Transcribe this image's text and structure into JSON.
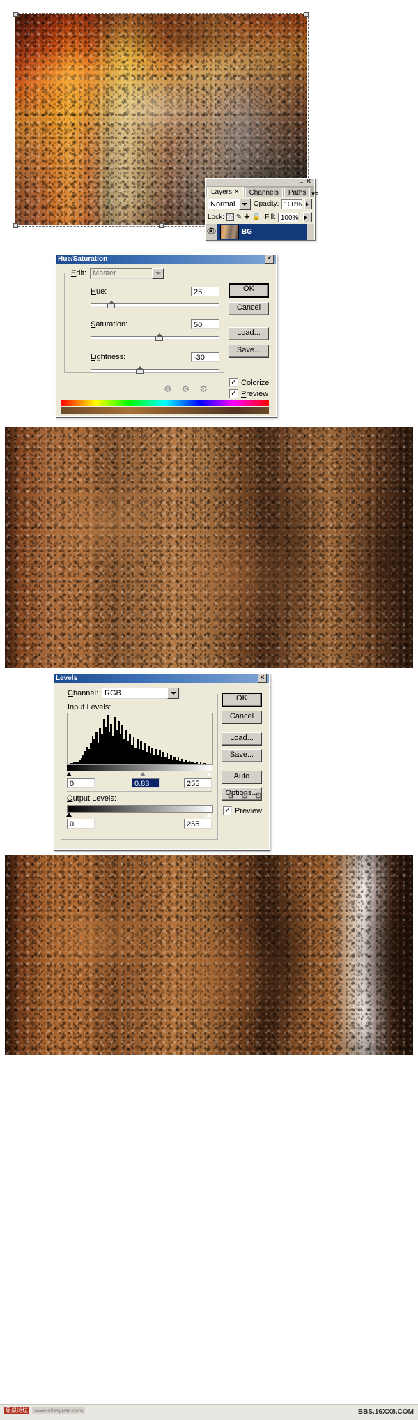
{
  "app": "Adobe Photoshop tutorial screenshot",
  "layers_palette": {
    "tabs": [
      {
        "label": "Layers",
        "active": true,
        "close_icon": "close-x-icon"
      },
      {
        "label": "Channels",
        "active": false
      },
      {
        "label": "Paths",
        "active": false
      }
    ],
    "menu_icon": "palette-menu-icon",
    "minimize_icon": "minimize-icon",
    "close_icon": "close-icon",
    "blend_mode": "Normal",
    "opacity_label": "Opacity:",
    "opacity_value": "100%",
    "lock_label": "Lock:",
    "lock_icons": [
      "lock-transparent-pixels-icon",
      "lock-image-pixels-icon",
      "lock-position-icon",
      "lock-all-icon"
    ],
    "fill_label": "Fill:",
    "fill_value": "100%",
    "layer": {
      "name": "BG",
      "visible": true,
      "eye_icon": "eye-visibility-icon"
    }
  },
  "hue_saturation_dialog": {
    "title": "Hue/Saturation",
    "close_icon": "close-icon",
    "edit_label": "Edit:",
    "edit_value": "Master",
    "fields": [
      {
        "label": "Hue:",
        "value": "25",
        "slider_pct": 13
      },
      {
        "label": "Saturation:",
        "value": "50",
        "slider_pct": 50
      },
      {
        "label": "Lightness:",
        "value": "-30",
        "slider_pct": 35
      }
    ],
    "buttons": [
      {
        "label": "OK",
        "default": true
      },
      {
        "label": "Cancel",
        "default": false
      },
      {
        "label": "Load...",
        "default": false
      },
      {
        "label": "Save...",
        "default": false
      }
    ],
    "checkboxes": [
      {
        "label": "Colorize",
        "checked": true
      },
      {
        "label": "Preview",
        "checked": true
      }
    ],
    "eyedropper_icons": [
      "eyedropper-icon",
      "eyedropper-plus-icon",
      "eyedropper-minus-icon"
    ],
    "spectrum_bars": 2
  },
  "levels_dialog": {
    "title": "Levels",
    "close_icon": "close-icon",
    "channel_label": "Channel:",
    "channel_value": "RGB",
    "input_levels_label": "Input Levels:",
    "input_values": [
      "0",
      "0.83",
      "255"
    ],
    "input_selected_index": 1,
    "output_levels_label": "Output Levels:",
    "output_values": [
      "0",
      "255"
    ],
    "buttons": [
      {
        "label": "OK",
        "default": true
      },
      {
        "label": "Cancel",
        "default": false
      },
      {
        "label": "Load...",
        "default": false
      },
      {
        "label": "Save...",
        "default": false
      },
      {
        "label": "Auto",
        "default": false
      },
      {
        "label": "Options...",
        "default": false
      }
    ],
    "preview": {
      "label": "Preview",
      "checked": true
    },
    "eyedropper_icons": [
      "eyedropper-black-icon",
      "eyedropper-gray-icon",
      "eyedropper-white-icon"
    ],
    "histogram": [
      2,
      3,
      3,
      4,
      5,
      6,
      8,
      12,
      18,
      26,
      34,
      30,
      42,
      55,
      48,
      62,
      40,
      70,
      58,
      88,
      72,
      96,
      64,
      78,
      55,
      92,
      68,
      84,
      58,
      76,
      50,
      66,
      44,
      60,
      38,
      54,
      33,
      48,
      30,
      44,
      27,
      40,
      24,
      36,
      21,
      33,
      19,
      30,
      17,
      27,
      15,
      24,
      13,
      21,
      11,
      18,
      9,
      15,
      8,
      13,
      7,
      11,
      6,
      9,
      5,
      7,
      4,
      6,
      3,
      5,
      2,
      4,
      2,
      3,
      1,
      2,
      1,
      1
    ]
  },
  "photos": [
    {
      "name": "original-rusty-metal-texture",
      "caption": ""
    },
    {
      "name": "colorized-rust-texture",
      "caption": ""
    },
    {
      "name": "final-rust-texture-after-levels",
      "caption": ""
    }
  ],
  "footer": {
    "badge": "思缘论坛",
    "url": "www.missyuan.com",
    "site": "BBS.16XX8.COM"
  },
  "colors": {
    "titlebar_blue": "#1d4a8f",
    "layer_selected": "#123a7a",
    "dialog_face": "#ece9d8",
    "selection_highlight": "#0a246a"
  }
}
